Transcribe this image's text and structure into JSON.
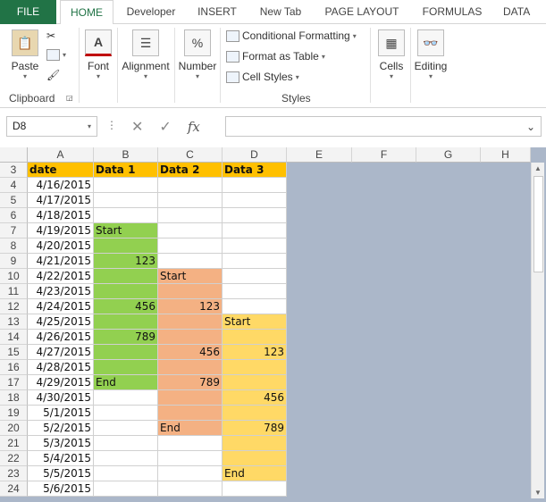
{
  "tabs": [
    "FILE",
    "HOME",
    "Developer",
    "INSERT",
    "New Tab",
    "PAGE LAYOUT",
    "FORMULAS",
    "DATA"
  ],
  "ribbon": {
    "clipboard": {
      "paste": "Paste",
      "group": "Clipboard"
    },
    "font": "Font",
    "alignment": "Alignment",
    "number": "Number",
    "styles": {
      "conditional": "Conditional Formatting",
      "table": "Format as Table",
      "cell_styles": "Cell Styles",
      "group": "Styles"
    },
    "cells": "Cells",
    "editing": "Editing"
  },
  "formula_bar": {
    "name_box": "D8",
    "formula": "",
    "fx": "fx"
  },
  "columns": [
    "A",
    "B",
    "C",
    "D",
    "E",
    "F",
    "G",
    "H"
  ],
  "rows": [
    "3",
    "4",
    "5",
    "6",
    "7",
    "8",
    "9",
    "10",
    "11",
    "12",
    "13",
    "14",
    "15",
    "16",
    "17",
    "18",
    "19",
    "20",
    "21",
    "22",
    "23",
    "24"
  ],
  "header": {
    "a": "date",
    "b": "Data 1",
    "c": "Data 2",
    "d": "Data 3"
  },
  "table": [
    {
      "a": "4/16/2015",
      "b": "",
      "c": "",
      "d": ""
    },
    {
      "a": "4/17/2015",
      "b": "",
      "c": "",
      "d": ""
    },
    {
      "a": "4/18/2015",
      "b": "",
      "c": "",
      "d": ""
    },
    {
      "a": "4/19/2015",
      "b": "Start",
      "c": "",
      "d": ""
    },
    {
      "a": "4/20/2015",
      "b": "",
      "c": "",
      "d": ""
    },
    {
      "a": "4/21/2015",
      "b": "123",
      "c": "",
      "d": ""
    },
    {
      "a": "4/22/2015",
      "b": "",
      "c": "Start",
      "d": ""
    },
    {
      "a": "4/23/2015",
      "b": "",
      "c": "",
      "d": ""
    },
    {
      "a": "4/24/2015",
      "b": "456",
      "c": "123",
      "d": ""
    },
    {
      "a": "4/25/2015",
      "b": "",
      "c": "",
      "d": "Start"
    },
    {
      "a": "4/26/2015",
      "b": "789",
      "c": "",
      "d": ""
    },
    {
      "a": "4/27/2015",
      "b": "",
      "c": "456",
      "d": "123"
    },
    {
      "a": "4/28/2015",
      "b": "",
      "c": "",
      "d": ""
    },
    {
      "a": "4/29/2015",
      "b": "End",
      "c": "789",
      "d": ""
    },
    {
      "a": "4/30/2015",
      "b": "",
      "c": "",
      "d": "456"
    },
    {
      "a": "5/1/2015",
      "b": "",
      "c": "",
      "d": ""
    },
    {
      "a": "5/2/2015",
      "b": "",
      "c": "End",
      "d": "789"
    },
    {
      "a": "5/3/2015",
      "b": "",
      "c": "",
      "d": ""
    },
    {
      "a": "5/4/2015",
      "b": "",
      "c": "",
      "d": ""
    },
    {
      "a": "5/5/2015",
      "b": "",
      "c": "",
      "d": "End"
    },
    {
      "a": "5/6/2015",
      "b": "",
      "c": "",
      "d": ""
    }
  ],
  "fills": {
    "b": [
      "",
      "",
      "",
      "g",
      "g",
      "g",
      "g",
      "g",
      "g",
      "g",
      "g",
      "g",
      "g",
      "g",
      "",
      "",
      "",
      "",
      "",
      "",
      ""
    ],
    "c": [
      "",
      "",
      "",
      "",
      "",
      "",
      "o",
      "o",
      "o",
      "o",
      "o",
      "o",
      "o",
      "o",
      "o",
      "o",
      "o",
      "",
      "",
      "",
      ""
    ],
    "d": [
      "",
      "",
      "",
      "",
      "",
      "",
      "",
      "",
      "",
      "y",
      "y",
      "y",
      "y",
      "y",
      "y",
      "y",
      "y",
      "y",
      "y",
      "y",
      ""
    ]
  },
  "colors": {
    "accent": "#217346",
    "header": "#ffc000",
    "green": "#92d050",
    "orange": "#f4b183",
    "yellow": "#ffd966",
    "sheet_bg": "#abb7c9"
  }
}
